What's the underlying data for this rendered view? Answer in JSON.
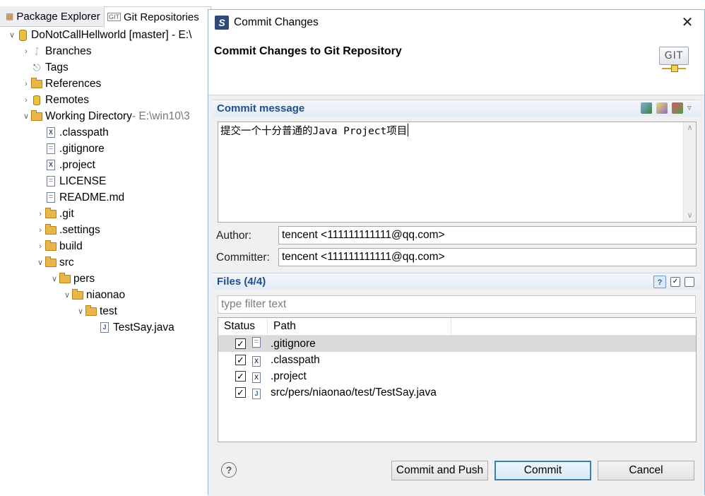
{
  "tabs": [
    {
      "label": "Package Explorer",
      "icon": "package-explorer-icon"
    },
    {
      "label": "Git Repositories",
      "icon": "git-repositories-icon"
    }
  ],
  "tree": {
    "repo": "DoNotCallHellworld [master] - E:\\",
    "items": [
      {
        "label": "Branches"
      },
      {
        "label": "Tags"
      },
      {
        "label": "References"
      },
      {
        "label": "Remotes"
      },
      {
        "label": "Working Directory",
        "suffix": " - E:\\win10\\3"
      },
      {
        "label": ".classpath"
      },
      {
        "label": ".gitignore"
      },
      {
        "label": ".project"
      },
      {
        "label": "LICENSE"
      },
      {
        "label": "README.md"
      },
      {
        "label": ".git"
      },
      {
        "label": ".settings"
      },
      {
        "label": "build"
      },
      {
        "label": "src"
      },
      {
        "label": "pers"
      },
      {
        "label": "niaonao"
      },
      {
        "label": "test"
      },
      {
        "label": "TestSay.java"
      }
    ]
  },
  "dialog": {
    "title": "Commit Changes",
    "banner_title": "Commit Changes to Git Repository",
    "logo_text": "GIT",
    "commit_message_heading": "Commit message",
    "commit_message": "提交一个十分普通的Java Project项目",
    "author_label": "Author:",
    "author_value": "tencent <111111111111@qq.com>",
    "committer_label": "Committer:",
    "committer_value": "tencent <111111111111@qq.com>",
    "files_heading": "Files (4/4)",
    "filter_placeholder": "type filter text",
    "columns": [
      "Status",
      "Path"
    ],
    "files": [
      {
        "path": ".gitignore",
        "checked": true
      },
      {
        "path": ".classpath",
        "checked": true
      },
      {
        "path": ".project",
        "checked": true
      },
      {
        "path": "src/pers/niaonao/test/TestSay.java",
        "checked": true
      }
    ],
    "buttons": {
      "commit_and_push": "Commit and Push",
      "commit": "Commit",
      "cancel": "Cancel"
    }
  }
}
